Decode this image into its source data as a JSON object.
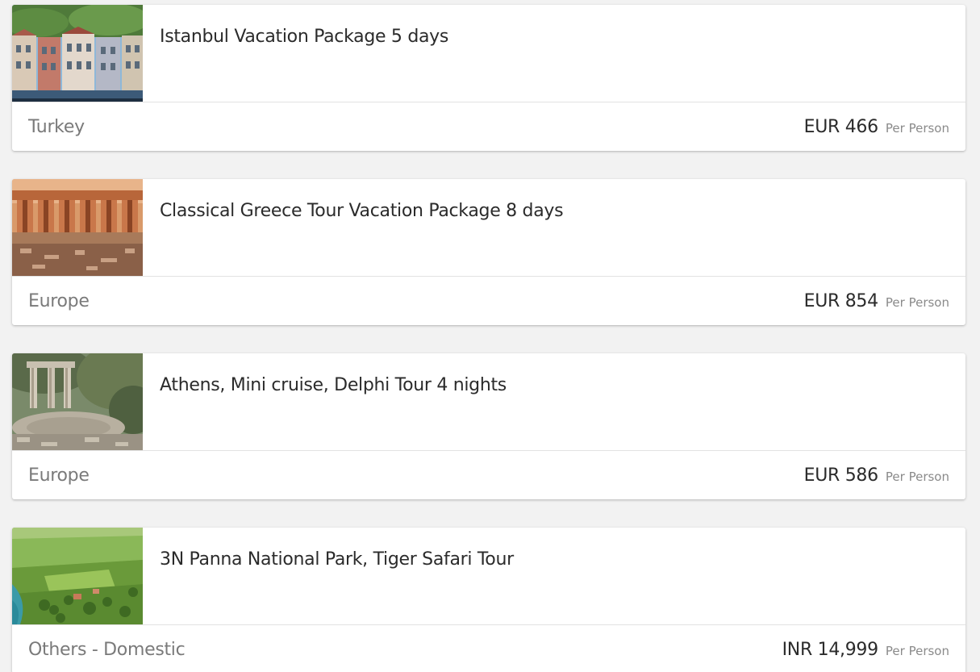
{
  "packages": [
    {
      "title": "Istanbul Vacation Package 5 days",
      "region": "Turkey",
      "price": "EUR 466",
      "per_label": "Per Person"
    },
    {
      "title": "Classical Greece Tour Vacation Package 8 days",
      "region": "Europe",
      "price": "EUR 854",
      "per_label": "Per Person"
    },
    {
      "title": "Athens, Mini cruise, Delphi Tour 4 nights",
      "region": "Europe",
      "price": "EUR 586",
      "per_label": "Per Person"
    },
    {
      "title": "3N Panna National Park, Tiger Safari Tour",
      "region": "Others - Domestic",
      "price": "INR 14,999",
      "per_label": "Per Person"
    }
  ],
  "colors": {
    "page_background": "#f2f2f2",
    "card_background": "#ffffff",
    "title_text": "#2b2b2b",
    "region_text": "#7a7a7a",
    "per_text": "#8a8a8a"
  }
}
